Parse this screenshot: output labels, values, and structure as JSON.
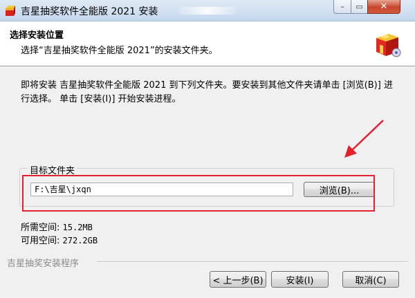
{
  "window": {
    "title": "吉星抽奖软件全能版 2021 安装",
    "min_symbol": "–",
    "max_symbol": "▭",
    "close_symbol": "✕"
  },
  "header": {
    "title": "选择安装位置",
    "subtitle": "选择“吉星抽奖软件全能版 2021”的安装文件夹。",
    "icon": "installer-box-icon"
  },
  "description": "即将安装 吉星抽奖软件全能版 2021 到下列文件夹。要安装到其他文件夹请单击 [浏览(B)] 进行选择。 单击 [安装(I)] 开始安装进程。",
  "destination": {
    "group_label": "目标文件夹",
    "path_value": "F:\\吉星\\jxqn",
    "browse_label": "浏览(B)..."
  },
  "space": {
    "required_label": "所需空间:",
    "required_value": "15.2MB",
    "available_label": "可用空间:",
    "available_value": "272.2GB"
  },
  "footer": {
    "brand": "吉星抽奖安装程序",
    "back_label": "< 上一步(B)",
    "install_label": "安装(I)",
    "cancel_label": "取消(C)"
  },
  "annotation": {
    "color": "#e3202e"
  }
}
